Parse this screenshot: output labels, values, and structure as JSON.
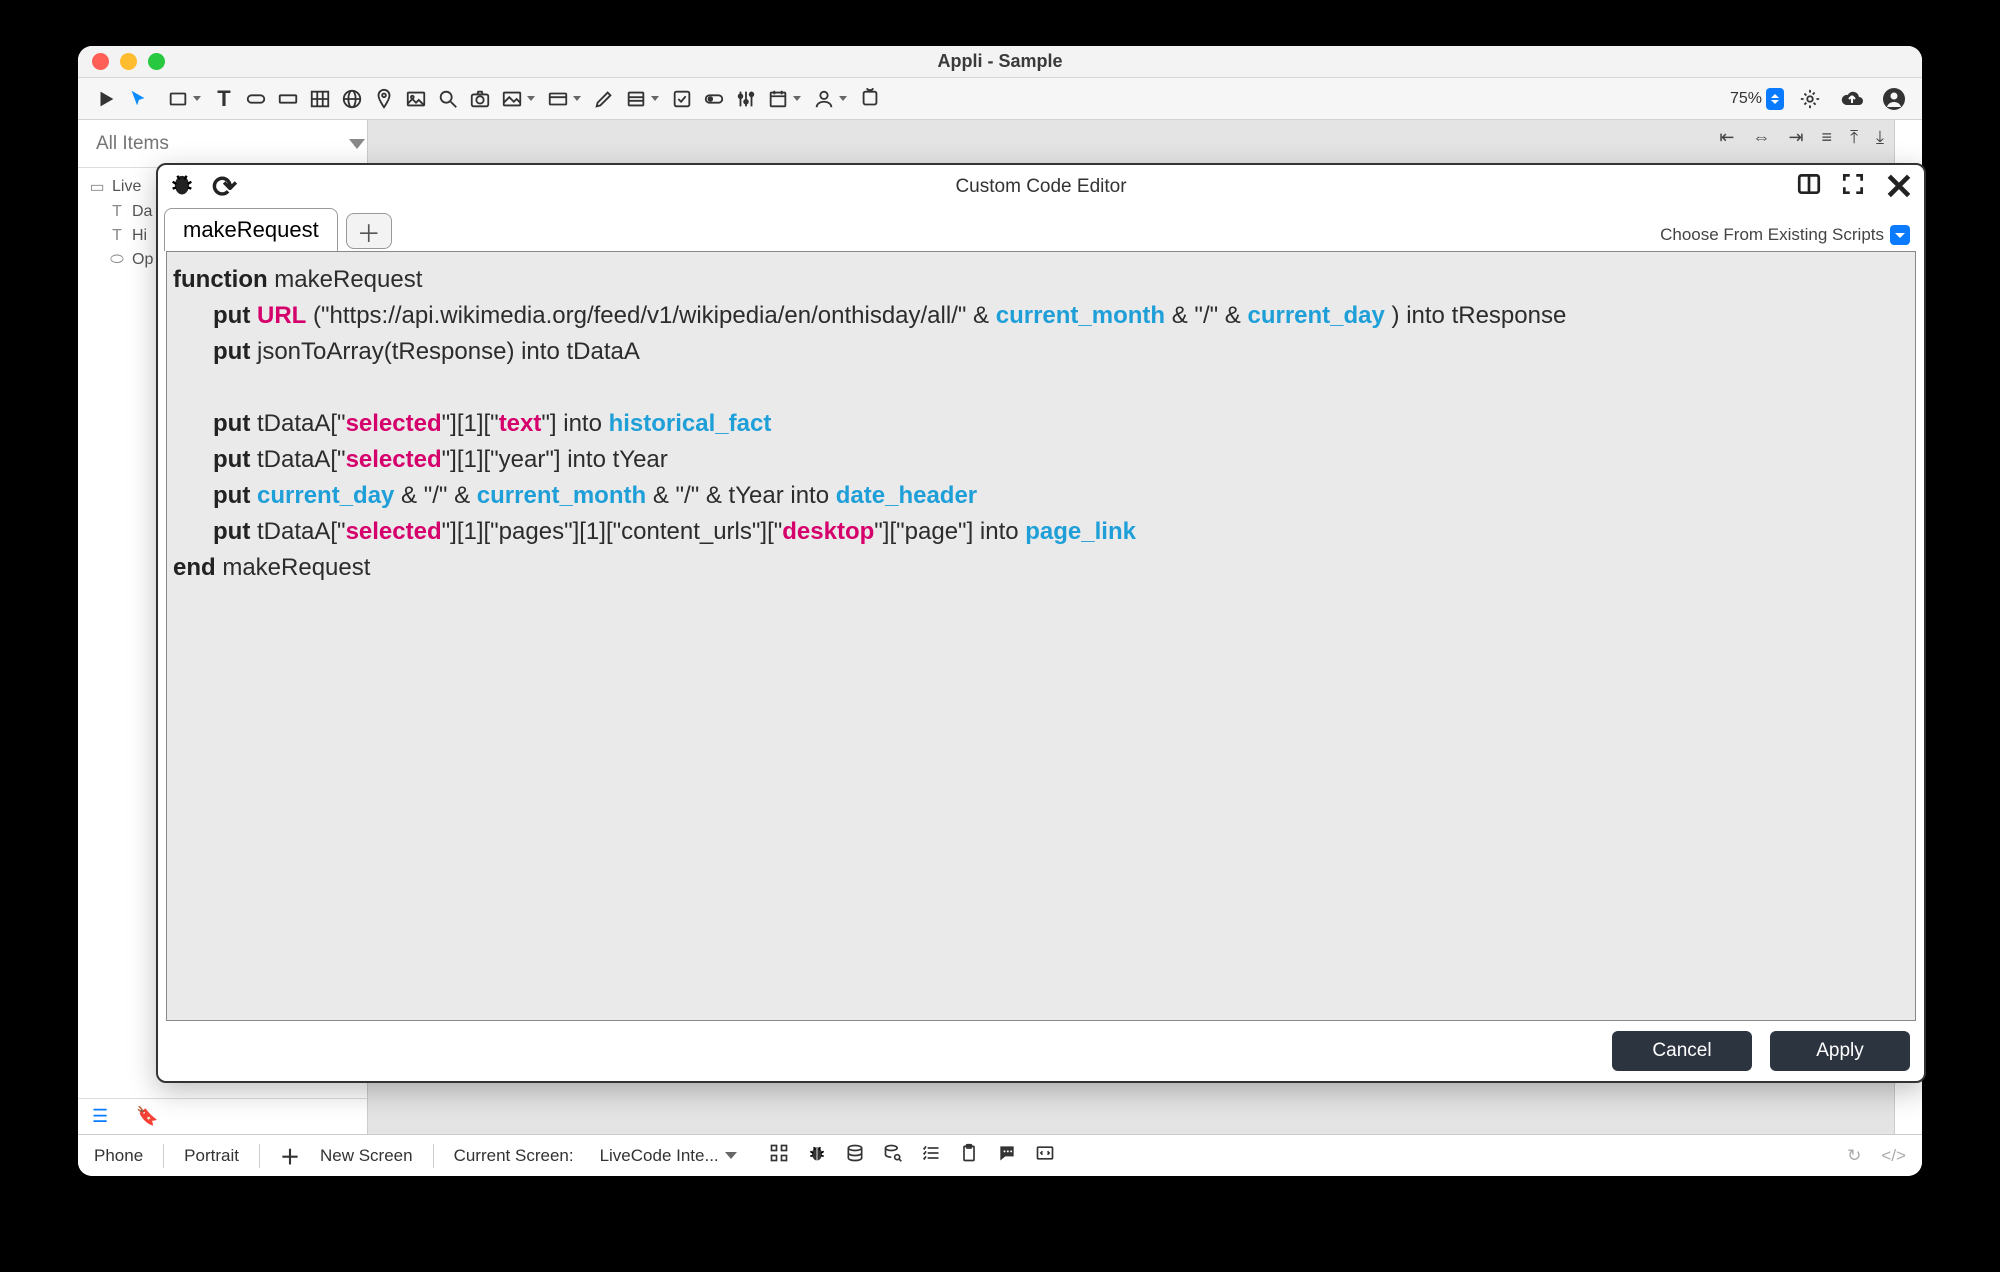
{
  "window": {
    "title": "Appli - Sample"
  },
  "zoom": "75%",
  "search": {
    "placeholder": "All Items"
  },
  "tree": {
    "items": [
      "Live",
      "Da",
      "Hi",
      "Op"
    ]
  },
  "align_icons": [
    "align-left",
    "align-h-center",
    "align-right",
    "align-justify",
    "align-v-top",
    "align-v-bottom"
  ],
  "status": {
    "device": "Phone",
    "orientation": "Portrait",
    "new_screen": "New Screen",
    "current_label": "Current Screen:",
    "current_value": "LiveCode Inte..."
  },
  "modal": {
    "title": "Custom Code Editor",
    "tab": "makeRequest",
    "scripts_label": "Choose From Existing Scripts",
    "cancel": "Cancel",
    "apply": "Apply"
  },
  "code": {
    "l1a": "function",
    "l1b": " makeRequest",
    "l2a": "put",
    "l2b": " ",
    "l2c": "URL",
    "l2d": " (\"https://api.wikimedia.org/feed/v1/wikipedia/en/onthisday/all/\" & ",
    "l2e": "current_month",
    "l2f": " & \"/\" & ",
    "l2g": "current_day",
    "l2h": " ) into tResponse",
    "l3a": "put",
    "l3b": " jsonToArray(tResponse) into tDataA",
    "l5a": "put",
    "l5b": " tDataA[\"",
    "l5c": "selected",
    "l5d": "\"][1][\"",
    "l5e": "text",
    "l5f": "\"] into ",
    "l5g": "historical_fact",
    "l6a": "put",
    "l6b": " tDataA[\"",
    "l6c": "selected",
    "l6d": "\"][1][\"year\"] into tYear",
    "l7a": "put",
    "l7b": " ",
    "l7c": "current_day",
    "l7d": " & \"/\" & ",
    "l7e": "current_month",
    "l7f": " & \"/\" & tYear into ",
    "l7g": "date_header",
    "l8a": "put",
    "l8b": " tDataA[\"",
    "l8c": "selected",
    "l8d": "\"][1][\"pages\"][1][\"content_urls\"][\"",
    "l8e": "desktop",
    "l8f": "\"][\"page\"] into ",
    "l8g": "page_link",
    "l9a": "end",
    "l9b": " makeRequest"
  }
}
